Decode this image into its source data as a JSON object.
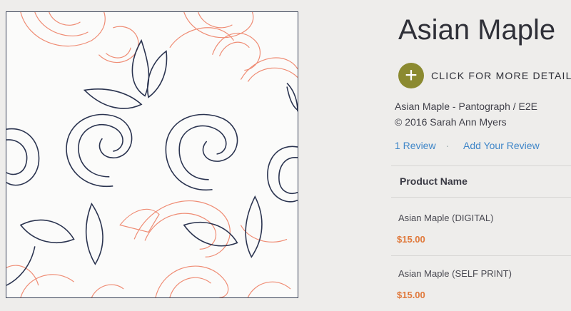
{
  "product": {
    "title": "Asian Maple",
    "details_link": "CLICK FOR MORE DETAILS",
    "subtitle": "Asian Maple - Pantograph / E2E",
    "copyright": "© 2016 Sarah Ann Myers"
  },
  "reviews": {
    "count_label": "1  Review",
    "add_label": "Add Your Review"
  },
  "table": {
    "column_header": "Product Name",
    "rows": [
      {
        "name": "Asian Maple (DIGITAL)",
        "price": "$15.00"
      },
      {
        "name": "Asian Maple (SELF PRINT)",
        "price": "$15.00"
      }
    ]
  },
  "colors": {
    "accent_button": "#8b8a30",
    "price": "#e0783a",
    "link": "#3f86c8",
    "pattern_dark": "#2b3450",
    "pattern_light": "#ef8c74"
  },
  "icons": {
    "details_button": "plus-icon"
  }
}
